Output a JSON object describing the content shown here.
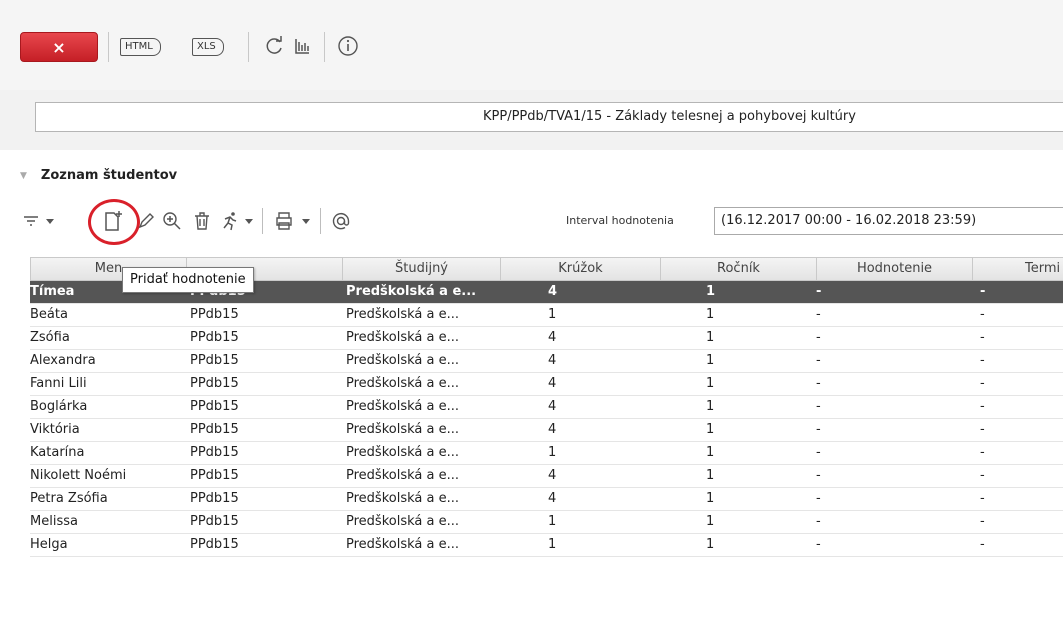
{
  "toolbar": {
    "close_label": "×",
    "html_label": "HTML",
    "xls_label": "XLS",
    "refresh_icon": "refresh-icon",
    "structure_icon": "structure-icon",
    "info_icon": "info-icon"
  },
  "course_title": "KPP/PPdb/TVA1/15 - Základy telesnej a pohybovej kultúry",
  "section": {
    "title": "Zoznam študentov"
  },
  "list_toolbar": {
    "interval_label": "Interval hodnotenia",
    "interval_value": "(16.12.2017 00:00 - 16.02.2018 23:59)",
    "tooltip": "Pridať hodnotenie"
  },
  "table": {
    "columns": [
      "Men",
      "",
      "Študijný",
      "Krúžok",
      "Ročník",
      "Hodnotenie",
      "Termi"
    ],
    "rows": [
      {
        "name": "Tímea",
        "group": "PPdb15",
        "program": "Predškolská a e...",
        "kruzok": "4",
        "rocnik": "1",
        "hodnotenie": "-",
        "termin": "-"
      },
      {
        "name": "Beáta",
        "group": "PPdb15",
        "program": "Predškolská a e...",
        "kruzok": "1",
        "rocnik": "1",
        "hodnotenie": "-",
        "termin": "-"
      },
      {
        "name": "Zsófia",
        "group": "PPdb15",
        "program": "Predškolská a e...",
        "kruzok": "4",
        "rocnik": "1",
        "hodnotenie": "-",
        "termin": "-"
      },
      {
        "name": "Alexandra",
        "group": "PPdb15",
        "program": "Predškolská a e...",
        "kruzok": "4",
        "rocnik": "1",
        "hodnotenie": "-",
        "termin": "-"
      },
      {
        "name": "Fanni Lili",
        "group": "PPdb15",
        "program": "Predškolská a e...",
        "kruzok": "4",
        "rocnik": "1",
        "hodnotenie": "-",
        "termin": "-"
      },
      {
        "name": "Boglárka",
        "group": "PPdb15",
        "program": "Predškolská a e...",
        "kruzok": "4",
        "rocnik": "1",
        "hodnotenie": "-",
        "termin": "-"
      },
      {
        "name": "Viktória",
        "group": "PPdb15",
        "program": "Predškolská a e...",
        "kruzok": "4",
        "rocnik": "1",
        "hodnotenie": "-",
        "termin": "-"
      },
      {
        "name": "Katarína",
        "group": "PPdb15",
        "program": "Predškolská a e...",
        "kruzok": "1",
        "rocnik": "1",
        "hodnotenie": "-",
        "termin": "-"
      },
      {
        "name": "Nikolett Noémi",
        "group": "PPdb15",
        "program": "Predškolská a e...",
        "kruzok": "4",
        "rocnik": "1",
        "hodnotenie": "-",
        "termin": "-"
      },
      {
        "name": "Petra Zsófia",
        "group": "PPdb15",
        "program": "Predškolská a e...",
        "kruzok": "4",
        "rocnik": "1",
        "hodnotenie": "-",
        "termin": "-"
      },
      {
        "name": "Melissa",
        "group": "PPdb15",
        "program": "Predškolská a e...",
        "kruzok": "1",
        "rocnik": "1",
        "hodnotenie": "-",
        "termin": "-"
      },
      {
        "name": "Helga",
        "group": "PPdb15",
        "program": "Predškolská a e...",
        "kruzok": "1",
        "rocnik": "1",
        "hodnotenie": "-",
        "termin": "-"
      }
    ]
  },
  "colors": {
    "close_red": "#d9313a",
    "selected_row": "#555555",
    "highlight_ring": "#d9202a"
  }
}
